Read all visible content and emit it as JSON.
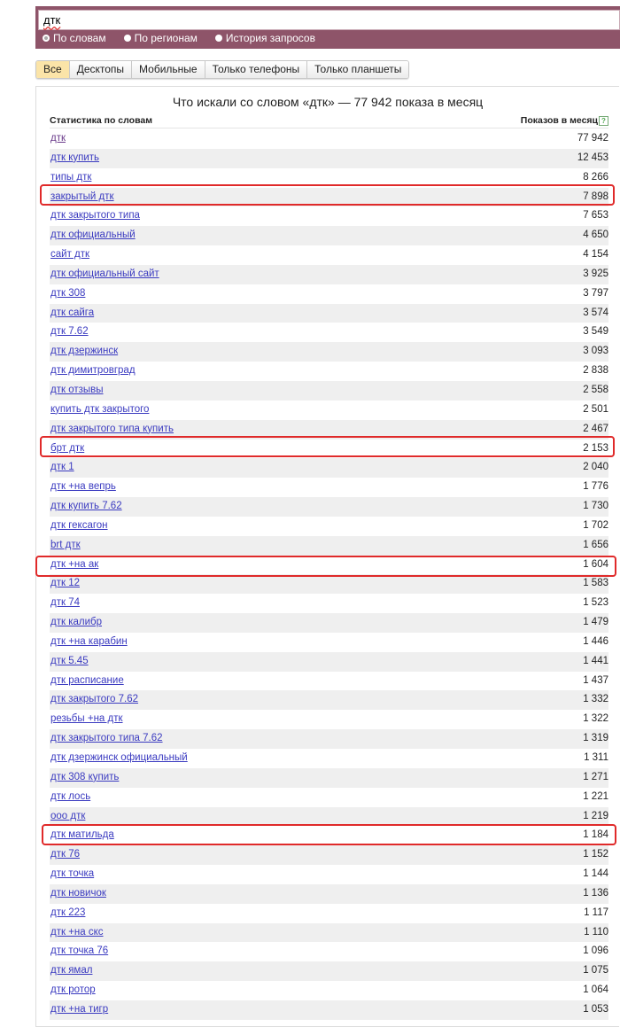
{
  "search": {
    "value": "дтк",
    "radios": [
      "По словам",
      "По регионам",
      "История запросов"
    ]
  },
  "tabs": [
    "Все",
    "Десктопы",
    "Мобильные",
    "Только телефоны",
    "Только планшеты"
  ],
  "panel": {
    "title": "Что искали со словом «дтк» — 77 942 показа в месяц",
    "col_left": "Статистика по словам",
    "col_right": "Показов в месяц",
    "help": "?"
  },
  "rows": [
    [
      "дтк",
      "77 942"
    ],
    [
      "дтк купить",
      "12 453"
    ],
    [
      "типы дтк",
      "8 266"
    ],
    [
      "закрытый дтк",
      "7 898"
    ],
    [
      "дтк закрытого типа",
      "7 653"
    ],
    [
      "дтк официальный",
      "4 650"
    ],
    [
      "сайт дтк",
      "4 154"
    ],
    [
      "дтк официальный сайт",
      "3 925"
    ],
    [
      "дтк 308",
      "3 797"
    ],
    [
      "дтк сайга",
      "3 574"
    ],
    [
      "дтк 7.62",
      "3 549"
    ],
    [
      "дтк дзержинск",
      "3 093"
    ],
    [
      "дтк димитровград",
      "2 838"
    ],
    [
      "дтк отзывы",
      "2 558"
    ],
    [
      "купить дтк закрытого",
      "2 501"
    ],
    [
      "дтк закрытого типа купить",
      "2 467"
    ],
    [
      "брт дтк",
      "2 153"
    ],
    [
      "дтк 1",
      "2 040"
    ],
    [
      "дтк +на вепрь",
      "1 776"
    ],
    [
      "дтк купить 7.62",
      "1 730"
    ],
    [
      "дтк гексагон",
      "1 702"
    ],
    [
      "brt дтк",
      "1 656"
    ],
    [
      "дтк +на ак",
      "1 604"
    ],
    [
      "дтк 12",
      "1 583"
    ],
    [
      "дтк 74",
      "1 523"
    ],
    [
      "дтк калибр",
      "1 479"
    ],
    [
      "дтк +на карабин",
      "1 446"
    ],
    [
      "дтк 5.45",
      "1 441"
    ],
    [
      "дтк расписание",
      "1 437"
    ],
    [
      "дтк закрытого 7.62",
      "1 332"
    ],
    [
      "резьбы +на дтк",
      "1 322"
    ],
    [
      "дтк закрытого типа 7.62",
      "1 319"
    ],
    [
      "дтк дзержинск официальный",
      "1 311"
    ],
    [
      "дтк 308 купить",
      "1 271"
    ],
    [
      "дтк лось",
      "1 221"
    ],
    [
      "ооо дтк",
      "1 219"
    ],
    [
      "дтк матильда",
      "1 184"
    ],
    [
      "дтк 76",
      "1 152"
    ],
    [
      "дтк точка",
      "1 144"
    ],
    [
      "дтк новичок",
      "1 136"
    ],
    [
      "дтк 223",
      "1 117"
    ],
    [
      "дтк +на скс",
      "1 110"
    ],
    [
      "дтк точка 76",
      "1 096"
    ],
    [
      "дтк ямал",
      "1 075"
    ],
    [
      "дтк ротор",
      "1 064"
    ],
    [
      "дтк +на тигр",
      "1 053"
    ]
  ],
  "highlight_color": "#e02a2a"
}
